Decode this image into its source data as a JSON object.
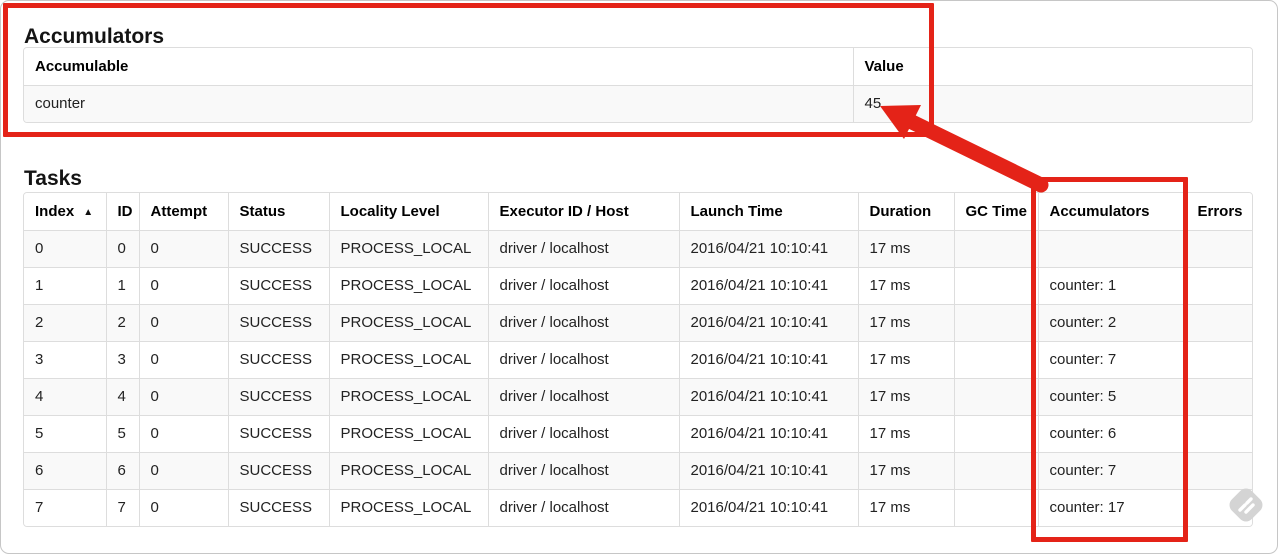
{
  "annotation": {
    "color": "#e42318"
  },
  "accumulators_section": {
    "title": "Accumulators",
    "table": {
      "columns": [
        "Accumulable",
        "Value"
      ],
      "rows": [
        {
          "accumulable": "counter",
          "value": "45"
        }
      ]
    }
  },
  "tasks_section": {
    "title": "Tasks",
    "table": {
      "columns": [
        "Index",
        "ID",
        "Attempt",
        "Status",
        "Locality Level",
        "Executor ID / Host",
        "Launch Time",
        "Duration",
        "GC Time",
        "Accumulators",
        "Errors"
      ],
      "sort_icon": "▲",
      "rows": [
        [
          "0",
          "0",
          "0",
          "SUCCESS",
          "PROCESS_LOCAL",
          "driver / localhost",
          "2016/04/21 10:10:41",
          "17 ms",
          "",
          "",
          ""
        ],
        [
          "1",
          "1",
          "0",
          "SUCCESS",
          "PROCESS_LOCAL",
          "driver / localhost",
          "2016/04/21 10:10:41",
          "17 ms",
          "",
          "counter: 1",
          ""
        ],
        [
          "2",
          "2",
          "0",
          "SUCCESS",
          "PROCESS_LOCAL",
          "driver / localhost",
          "2016/04/21 10:10:41",
          "17 ms",
          "",
          "counter: 2",
          ""
        ],
        [
          "3",
          "3",
          "0",
          "SUCCESS",
          "PROCESS_LOCAL",
          "driver / localhost",
          "2016/04/21 10:10:41",
          "17 ms",
          "",
          "counter: 7",
          ""
        ],
        [
          "4",
          "4",
          "0",
          "SUCCESS",
          "PROCESS_LOCAL",
          "driver / localhost",
          "2016/04/21 10:10:41",
          "17 ms",
          "",
          "counter: 5",
          ""
        ],
        [
          "5",
          "5",
          "0",
          "SUCCESS",
          "PROCESS_LOCAL",
          "driver / localhost",
          "2016/04/21 10:10:41",
          "17 ms",
          "",
          "counter: 6",
          ""
        ],
        [
          "6",
          "6",
          "0",
          "SUCCESS",
          "PROCESS_LOCAL",
          "driver / localhost",
          "2016/04/21 10:10:41",
          "17 ms",
          "",
          "counter: 7",
          ""
        ],
        [
          "7",
          "7",
          "0",
          "SUCCESS",
          "PROCESS_LOCAL",
          "driver / localhost",
          "2016/04/21 10:10:41",
          "17 ms",
          "",
          "counter: 17",
          ""
        ]
      ]
    }
  }
}
